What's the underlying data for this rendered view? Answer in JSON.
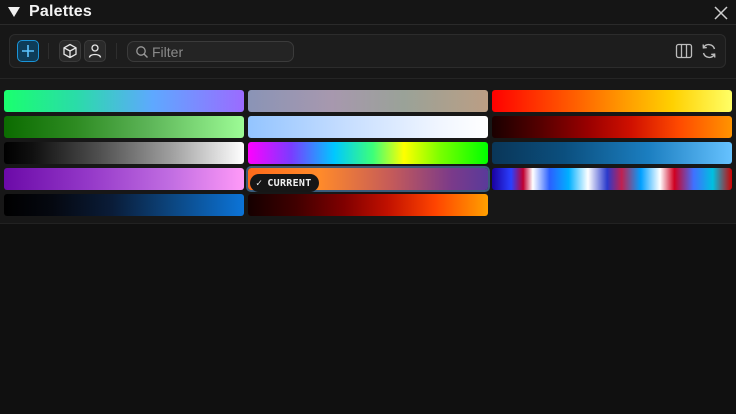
{
  "panel": {
    "title": "Palettes"
  },
  "toolbar": {
    "filter_placeholder": "Filter",
    "filter_value": ""
  },
  "palettes": [
    {
      "id": "p1",
      "gradient": "linear-gradient(90deg,#1aff6e 0%,#2adca8 30%,#5ea8ff 62%,#9b6bff 100%)"
    },
    {
      "id": "p2",
      "gradient": "linear-gradient(90deg,#8a94b6 0%,#a798ae 35%,#9aa298 65%,#bb9e84 100%)"
    },
    {
      "id": "p3",
      "gradient": "linear-gradient(90deg,#ff0000 0%,#ff2a00 15%,#ff6000 35%,#ff9a00 55%,#ffd000 75%,#ffff66 100%)"
    },
    {
      "id": "p4",
      "gradient": "linear-gradient(90deg,#0b6b00 0%,#2e8b22 30%,#5cb457 60%,#9dfc96 100%)"
    },
    {
      "id": "p5",
      "gradient": "linear-gradient(90deg,#93c4ff 0%,#c5ddff 40%,#f1f6ff 80%,#ffffff 100%)"
    },
    {
      "id": "p6",
      "gradient": "linear-gradient(90deg,#1a0000 0%,#550000 20%,#990000 40%,#d01000 58%,#ff4a00 78%,#ff9400 100%)"
    },
    {
      "id": "p7",
      "gradient": "linear-gradient(90deg,#000000 0%,#101010 12%,#505050 40%,#a0a0a0 70%,#ffffff 100%)"
    },
    {
      "id": "p8",
      "gradient": "linear-gradient(90deg,#ff00ff 0%,#7a3cff 18%,#00c8ff 36%,#3cff7a 52%,#ffff00 65%,#7aff00 80%,#00ff00 100%)"
    },
    {
      "id": "p9",
      "gradient": "linear-gradient(90deg,#0a3658 0%,#0b4f7e 30%,#1b7ec0 65%,#66c2ff 100%)"
    },
    {
      "id": "p10",
      "gradient": "linear-gradient(90deg,#6b0aa8 0%,#9438c8 35%,#c26ee2 70%,#ff9af8 100%)"
    },
    {
      "id": "p11",
      "gradient": "linear-gradient(90deg,#ff6a1a 0%,#ff8a2a 30%,#c45a5a 60%,#7a3a8a 85%,#5a3a9a 100%)",
      "current": true
    },
    {
      "id": "p12",
      "gradient": "linear-gradient(90deg,#1a00a0 0%,#2a40ff 8%,#c00030 13%,#ffffff 17%,#2a60ff 24%,#00b0ff 32%,#ffffff 40%,#2a3acc 48%,#c02050 54%,#00a0ff 62%,#ffffff 70%,#d00020 76%,#4070ff 84%,#00c0e0 92%,#d00000 100%)"
    },
    {
      "id": "p13",
      "gradient": "linear-gradient(90deg,#000000 0%,#050810 20%,#0a1c38 45%,#0c4680 70%,#0c74d8 100%)"
    },
    {
      "id": "p14",
      "gradient": "linear-gradient(90deg,#150000 0%,#400000 20%,#800000 40%,#c01000 58%,#ff4400 78%,#ffa000 100%)"
    }
  ],
  "current_badge": {
    "check": "✓",
    "label": "CURRENT"
  }
}
